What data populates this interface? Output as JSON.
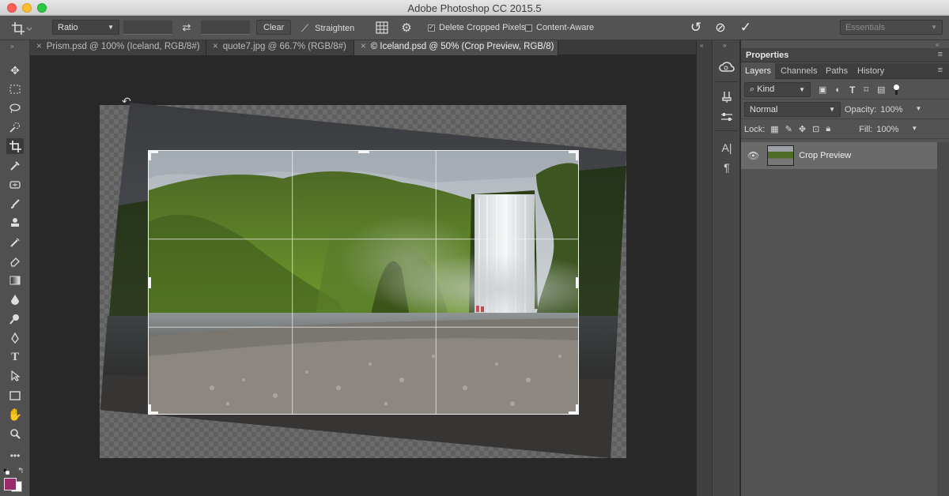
{
  "window": {
    "title": "Adobe Photoshop CC 2015.5"
  },
  "options": {
    "ratio_label": "Ratio",
    "swap_icon": "swap-arrows-icon",
    "clear_label": "Clear",
    "straighten_label": "Straighten",
    "delete_cropped_label": "Delete Cropped Pixels",
    "delete_cropped_checked": true,
    "content_aware_label": "Content-Aware",
    "content_aware_checked": false,
    "workspace_label": "Essentials"
  },
  "tabs": [
    {
      "label": "Prism.psd @ 100% (Iceland, RGB/8#)",
      "active": false
    },
    {
      "label": "quote7.jpg @ 66.7% (RGB/8#)",
      "active": false
    },
    {
      "label": "© Iceland.psd @ 50% (Crop Preview, RGB/8)",
      "active": true
    }
  ],
  "tools": [
    "move-tool-icon",
    "marquee-tool-icon",
    "lasso-tool-icon",
    "quick-select-tool-icon",
    "crop-tool-icon",
    "eyedropper-tool-icon",
    "healing-tool-icon",
    "brush-tool-icon",
    "stamp-tool-icon",
    "history-brush-icon",
    "eraser-tool-icon",
    "gradient-tool-icon",
    "blur-tool-icon",
    "dodge-tool-icon",
    "pen-tool-icon",
    "type-tool-icon",
    "path-select-tool-icon",
    "rectangle-tool-icon",
    "hand-tool-icon",
    "zoom-tool-icon",
    "more-tools-icon"
  ],
  "colors": {
    "foreground": "#9b2b6a",
    "background": "#ffffff",
    "panel": "#535353",
    "canvas": "#282828"
  },
  "panel": {
    "header": "Properties",
    "tabs": [
      "Layers",
      "Channels",
      "Paths",
      "History"
    ],
    "filter_kind": "Kind",
    "blend_mode": "Normal",
    "opacity_label": "Opacity:",
    "opacity_value": "100%",
    "lock_label": "Lock:",
    "fill_label": "Fill:",
    "fill_value": "100%",
    "layers": [
      {
        "name": "Crop Preview",
        "visible": true
      }
    ]
  }
}
